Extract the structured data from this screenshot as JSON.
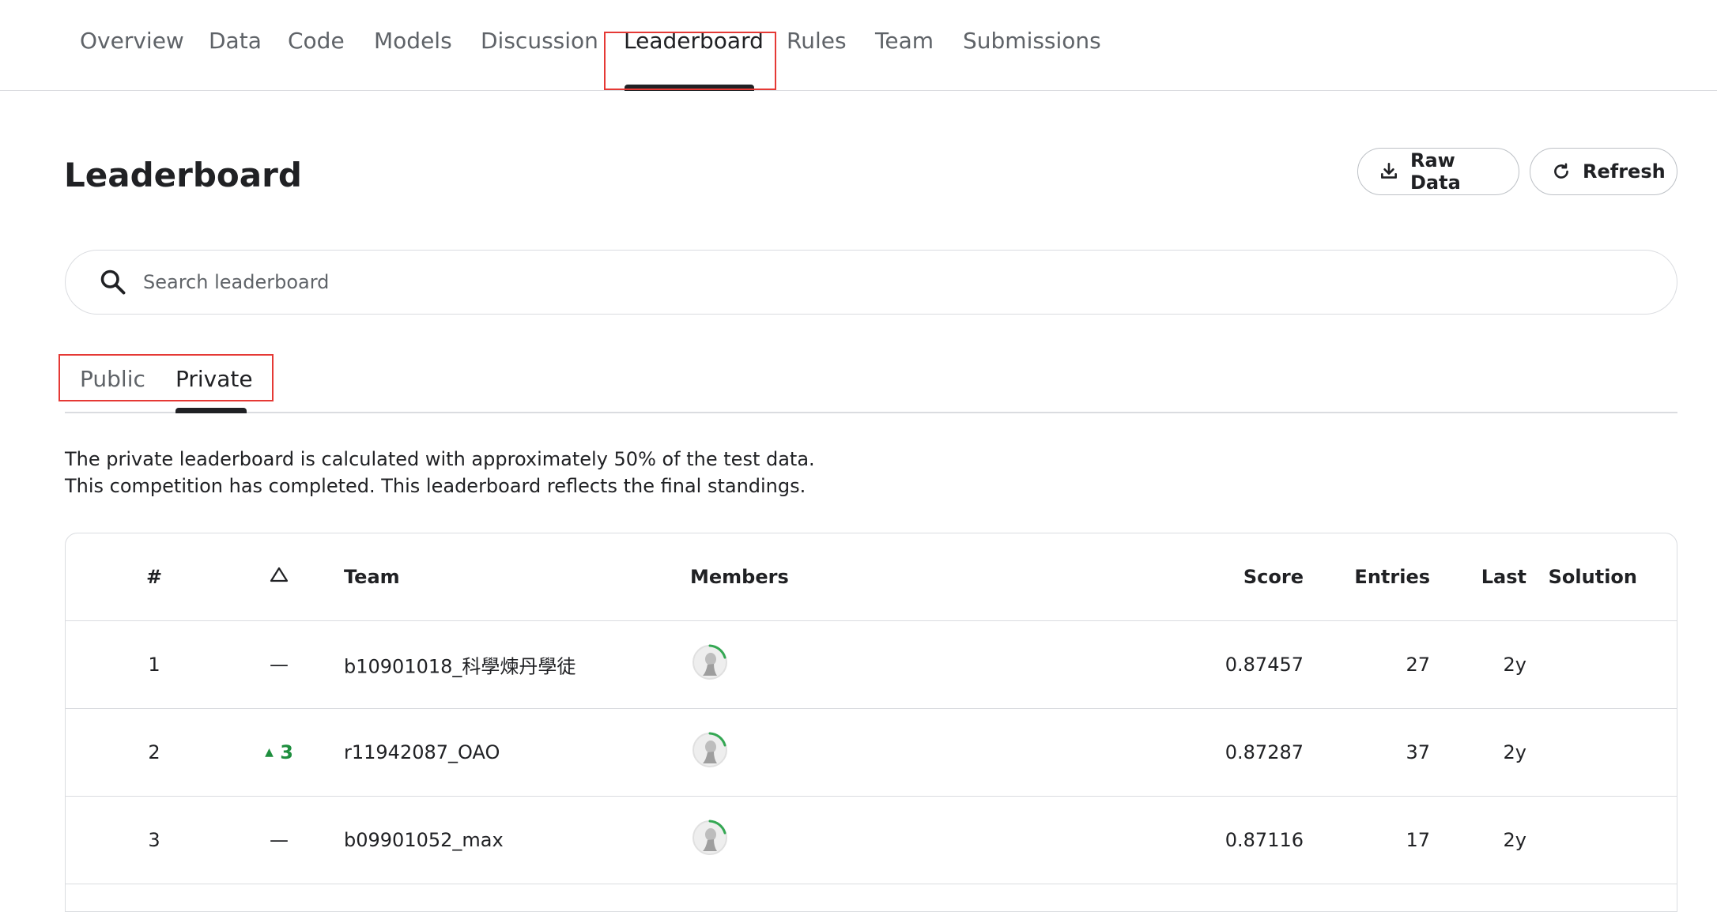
{
  "nav": {
    "tabs": [
      {
        "label": "Overview"
      },
      {
        "label": "Data"
      },
      {
        "label": "Code"
      },
      {
        "label": "Models"
      },
      {
        "label": "Discussion"
      },
      {
        "label": "Leaderboard"
      },
      {
        "label": "Rules"
      },
      {
        "label": "Team"
      },
      {
        "label": "Submissions"
      }
    ],
    "active": "Leaderboard"
  },
  "page": {
    "title": "Leaderboard",
    "raw_data_label": "Raw Data",
    "refresh_label": "Refresh"
  },
  "search": {
    "placeholder": "Search leaderboard"
  },
  "subtabs": {
    "public": "Public",
    "private": "Private",
    "active": "Private"
  },
  "info": {
    "line1": "The private leaderboard is calculated with approximately 50% of the test data.",
    "line2": "This competition has completed. This leaderboard reflects the final standings."
  },
  "table": {
    "headers": {
      "rank": "#",
      "team": "Team",
      "members": "Members",
      "score": "Score",
      "entries": "Entries",
      "last": "Last",
      "solution": "Solution"
    },
    "rows": [
      {
        "rank": "1",
        "delta": "—",
        "team": "b10901018_科學煉丹學徒",
        "score": "0.87457",
        "entries": "27",
        "last": "2y"
      },
      {
        "rank": "2",
        "delta": "3",
        "team": "r11942087_OAO",
        "score": "0.87287",
        "entries": "37",
        "last": "2y"
      },
      {
        "rank": "3",
        "delta": "—",
        "team": "b09901052_max",
        "score": "0.87116",
        "entries": "17",
        "last": "2y"
      }
    ]
  },
  "colors": {
    "accent": "#202124",
    "highlight": "#e53935",
    "up": "#1e8e3e",
    "border": "#dadce0"
  }
}
